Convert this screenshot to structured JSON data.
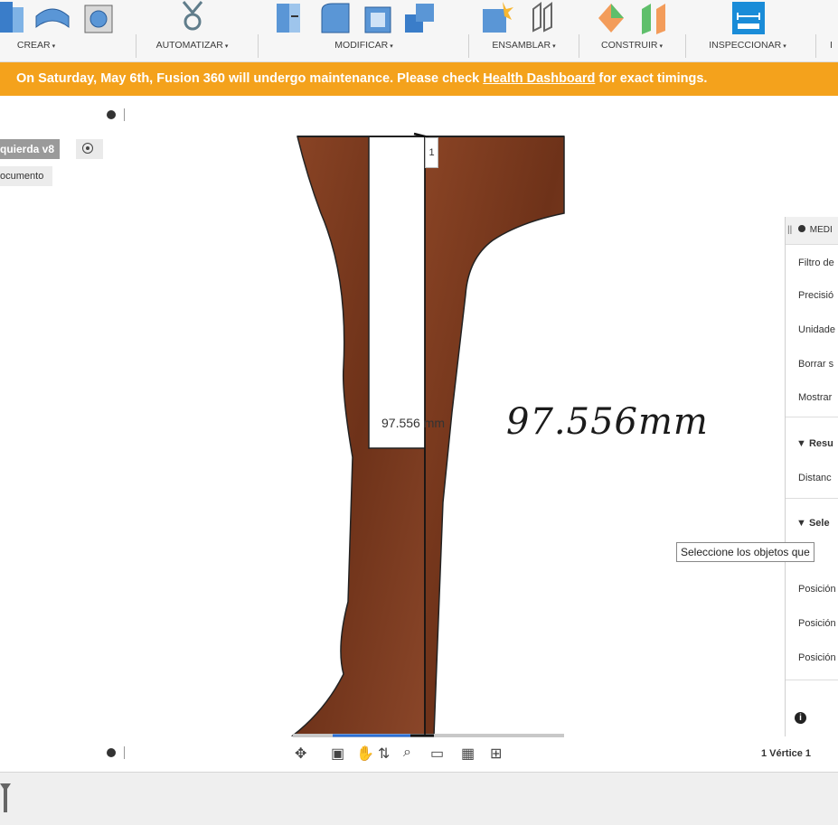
{
  "toolbar": {
    "groups": [
      {
        "label": "CREAR",
        "name": "crear"
      },
      {
        "label": "AUTOMATIZAR",
        "name": "automatizar"
      },
      {
        "label": "MODIFICAR",
        "name": "modificar"
      },
      {
        "label": "ENSAMBLAR",
        "name": "ensamblar"
      },
      {
        "label": "CONSTRUIR",
        "name": "construir"
      },
      {
        "label": "INSPECCIONAR",
        "name": "inspeccionar"
      },
      {
        "label": "I",
        "name": "insert-truncated"
      }
    ],
    "caret": "▾",
    "accent": "#1a8cd8"
  },
  "banner": {
    "text_before": "On Saturday, May 6th, Fusion 360 will undergo maintenance. Please check ",
    "link": "Health Dashboard",
    "text_after": " for exact timings.",
    "color": "#f4a21c"
  },
  "browser": {
    "document_name": "quierda v8",
    "settings_label": "ocumento"
  },
  "canvas": {
    "dimension_label": "97.556 mm",
    "handwritten_note": "97.556mm",
    "vertex_marker": "1",
    "body_color": "#7a3a1f"
  },
  "measure_panel": {
    "title": "MEDI",
    "rows": [
      "Filtro de",
      "Precisió",
      "Unidade",
      "Borrar s",
      "Mostrar"
    ],
    "section_results": "Resu",
    "distance_label": "Distanc",
    "section_selection": "Sele",
    "positions": [
      "Posición",
      "Posición",
      "Posición"
    ],
    "tooltip": "Seleccione los objetos que"
  },
  "status": {
    "selection": "1 Vértice 1"
  },
  "nav": {
    "icons": [
      "orbit-icon",
      "look-at-icon",
      "pan-icon",
      "zoom-icon",
      "fit-icon",
      "display-icon",
      "grid-icon",
      "viewports-icon"
    ]
  }
}
